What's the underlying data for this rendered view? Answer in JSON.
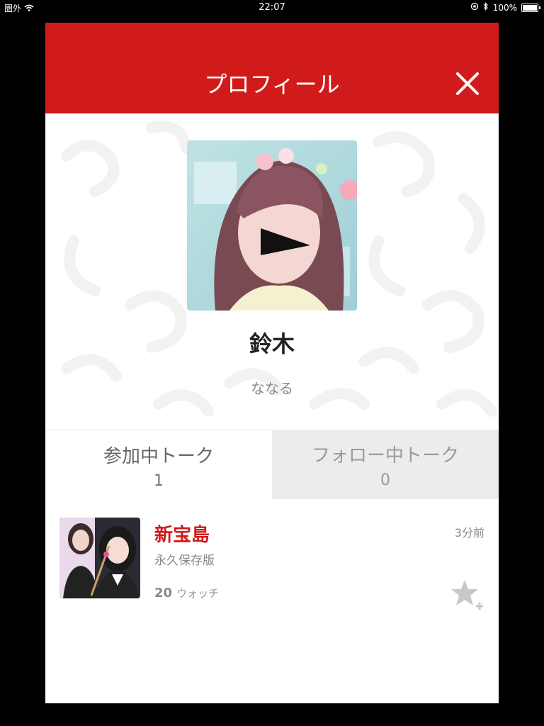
{
  "status_bar": {
    "carrier": "圏外",
    "time": "22:07",
    "battery_percent": "100%",
    "battery_level": 1.0
  },
  "header": {
    "title": "プロフィール"
  },
  "profile": {
    "name": "鈴木",
    "sub_name": "ななる"
  },
  "tabs": [
    {
      "label": "参加中トーク",
      "count": "1",
      "active": true
    },
    {
      "label": "フォロー中トーク",
      "count": "0",
      "active": false
    }
  ],
  "talks": [
    {
      "title": "新宝島",
      "subtitle": "永久保存版",
      "watch_count": "20",
      "watch_label": "ウォッチ",
      "time_ago": "3分前"
    }
  ],
  "colors": {
    "brand_red": "#d11b1b",
    "inactive_tab_bg": "#ececec",
    "pattern_gray": "#f2f2f2"
  },
  "icons": [
    "wifi-icon",
    "orientation-lock-icon",
    "bluetooth-icon",
    "battery-icon",
    "close-icon",
    "star-plus-icon"
  ]
}
